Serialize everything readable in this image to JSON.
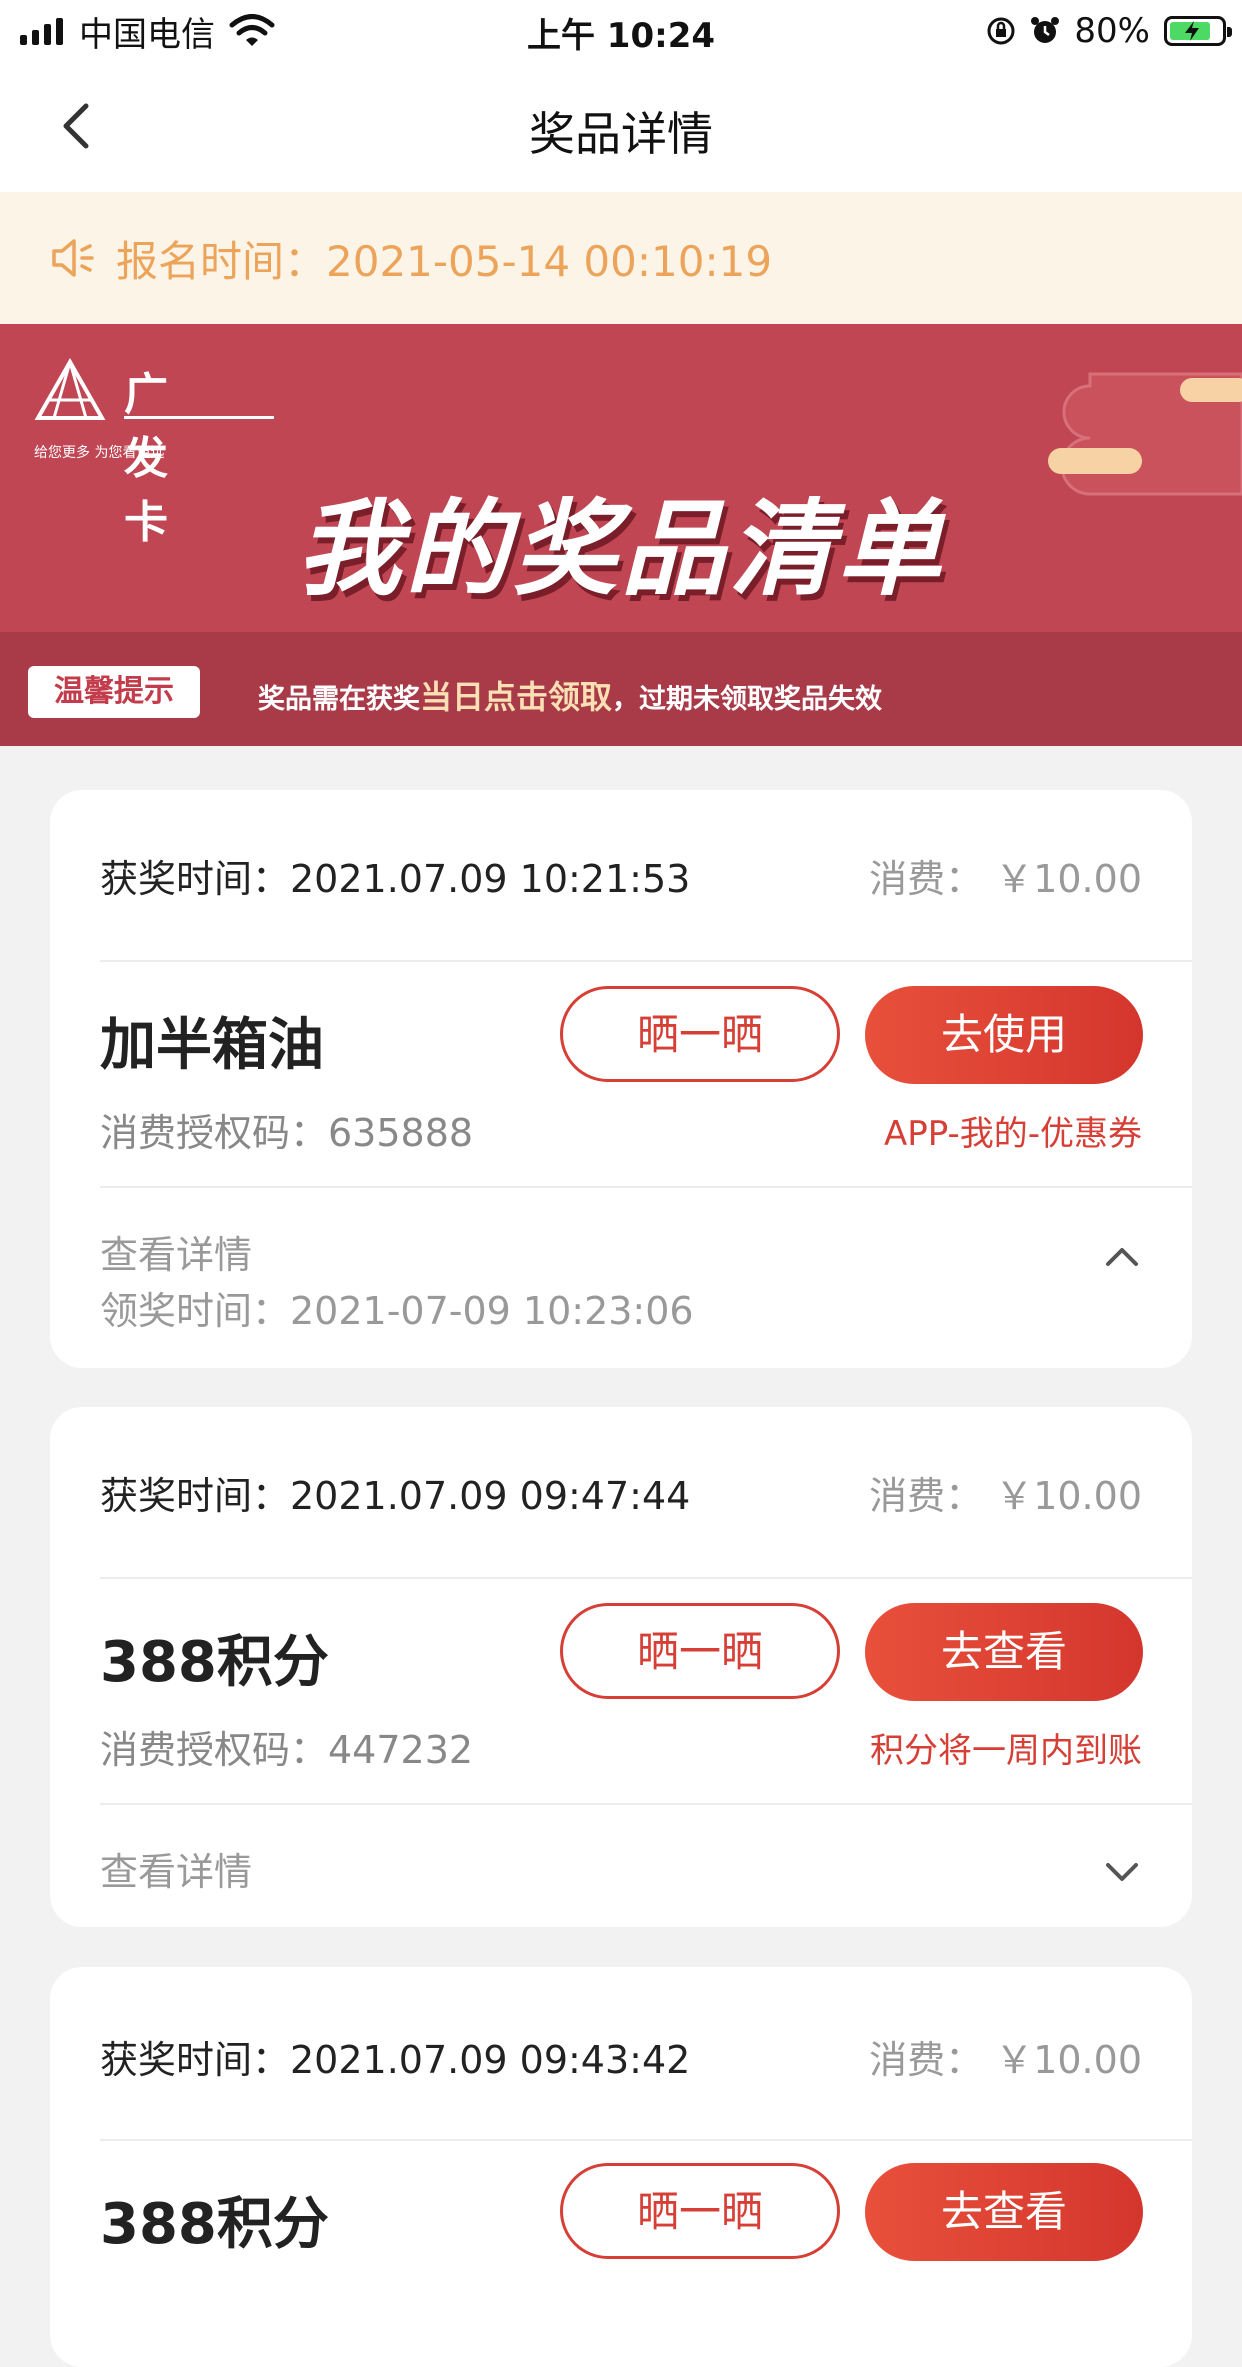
{
  "status_bar": {
    "carrier": "中国电信",
    "time": "上午 10:24",
    "battery": "80%"
  },
  "nav": {
    "title": "奖品详情"
  },
  "notice": {
    "text": "报名时间：2021-05-14 00:10:19"
  },
  "banner": {
    "logo_name": "广发卡",
    "logo_slogan": "给您更多  为您看更远",
    "title": "我的奖品清单",
    "tip_badge": "温馨提示",
    "tip_prefix": "奖品需在获奖",
    "tip_highlight": "当日点击领取",
    "tip_suffix": "，过期未领取奖品失效"
  },
  "prizes": [
    {
      "win_time": "获奖时间：2021.07.09 10:21:53",
      "fee": "消费： ￥10.00",
      "name": "加半箱油",
      "auth_code": "消费授权码：635888",
      "share_label": "晒一晒",
      "action_label": "去使用",
      "hint": "APP-我的-优惠券",
      "detail_label": "查看详情",
      "claim_time": "领奖时间：2021-07-09 10:23:06",
      "expanded": true
    },
    {
      "win_time": "获奖时间：2021.07.09 09:47:44",
      "fee": "消费： ￥10.00",
      "name": "388积分",
      "auth_code": "消费授权码：447232",
      "share_label": "晒一晒",
      "action_label": "去查看",
      "hint": "积分将一周内到账",
      "detail_label": "查看详情",
      "expanded": false
    },
    {
      "win_time": "获奖时间：2021.07.09 09:43:42",
      "fee": "消费： ￥10.00",
      "name": "388积分",
      "share_label": "晒一晒",
      "action_label": "去查看"
    }
  ],
  "colors": {
    "accent_red": "#d63f35",
    "notice_text": "#eba45a",
    "banner_bg": "#c04654"
  }
}
